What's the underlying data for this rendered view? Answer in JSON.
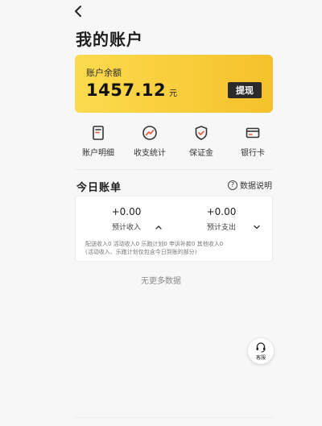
{
  "header": {
    "back_icon": "chevron-left-icon",
    "title": "我的账户"
  },
  "balance": {
    "label": "账户余额",
    "amount": "1457.12",
    "unit": "元",
    "withdraw_label": "提现",
    "gradient_start": "#fbdb4e",
    "gradient_end": "#f5c12b"
  },
  "actions": [
    {
      "label": "账户明细",
      "icon": "document-icon"
    },
    {
      "label": "收支统计",
      "icon": "chart-circle-icon"
    },
    {
      "label": "保证金",
      "icon": "shield-check-icon"
    },
    {
      "label": "银行卡",
      "icon": "card-icon"
    }
  ],
  "today": {
    "title": "今日账单",
    "help_label": "数据说明",
    "income_value": "+0.00",
    "income_label": "预计收入",
    "expense_value": "+0.00",
    "expense_label": "预计支出",
    "note_line1": "配送收入0 活动收入0 乐跑计划0 申诉补款0 其他收入0",
    "note_line2": "(活动收入、乐跑计划仅包含今日到账的部分)"
  },
  "no_more": "无更多数据",
  "service": {
    "label": "客服",
    "icon": "headset-icon"
  }
}
